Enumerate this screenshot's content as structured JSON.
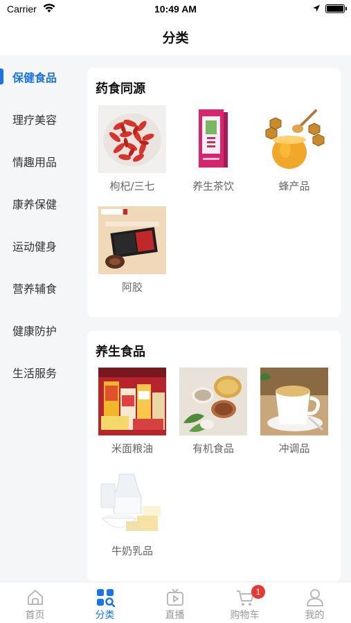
{
  "status_bar": {
    "carrier": "Carrier",
    "time": "10:49 AM"
  },
  "nav": {
    "title": "分类"
  },
  "sidebar": {
    "items": [
      {
        "label": "保健食品",
        "active": true
      },
      {
        "label": "理疗美容"
      },
      {
        "label": "情趣用品"
      },
      {
        "label": "康养保健"
      },
      {
        "label": "运动健身"
      },
      {
        "label": "营养辅食"
      },
      {
        "label": "健康防护"
      },
      {
        "label": "生活服务"
      }
    ]
  },
  "sections": [
    {
      "title": "药食同源",
      "products": [
        {
          "label": "枸杞/三七",
          "icon": "goji-berry-image"
        },
        {
          "label": "养生茶饮",
          "icon": "tea-box-image"
        },
        {
          "label": "蜂产品",
          "icon": "honey-image"
        },
        {
          "label": "阿胶",
          "icon": "ejiao-box-image"
        }
      ]
    },
    {
      "title": "养生食品",
      "products": [
        {
          "label": "米面粮油",
          "icon": "grain-oil-image"
        },
        {
          "label": "有机食品",
          "icon": "organic-grains-image"
        },
        {
          "label": "冲调品",
          "icon": "milk-tea-cup-image"
        },
        {
          "label": "牛奶乳品",
          "icon": "dairy-image"
        }
      ]
    }
  ],
  "tab_bar": {
    "items": [
      {
        "label": "首页",
        "icon": "home-icon"
      },
      {
        "label": "分类",
        "icon": "category-icon",
        "active": true
      },
      {
        "label": "直播",
        "icon": "live-tv-icon"
      },
      {
        "label": "购物车",
        "icon": "cart-icon",
        "badge": "1"
      },
      {
        "label": "我的",
        "icon": "profile-icon"
      }
    ]
  },
  "colors": {
    "accent": "#1a73e8",
    "badge": "#e53935",
    "background": "#f5f6f8"
  }
}
